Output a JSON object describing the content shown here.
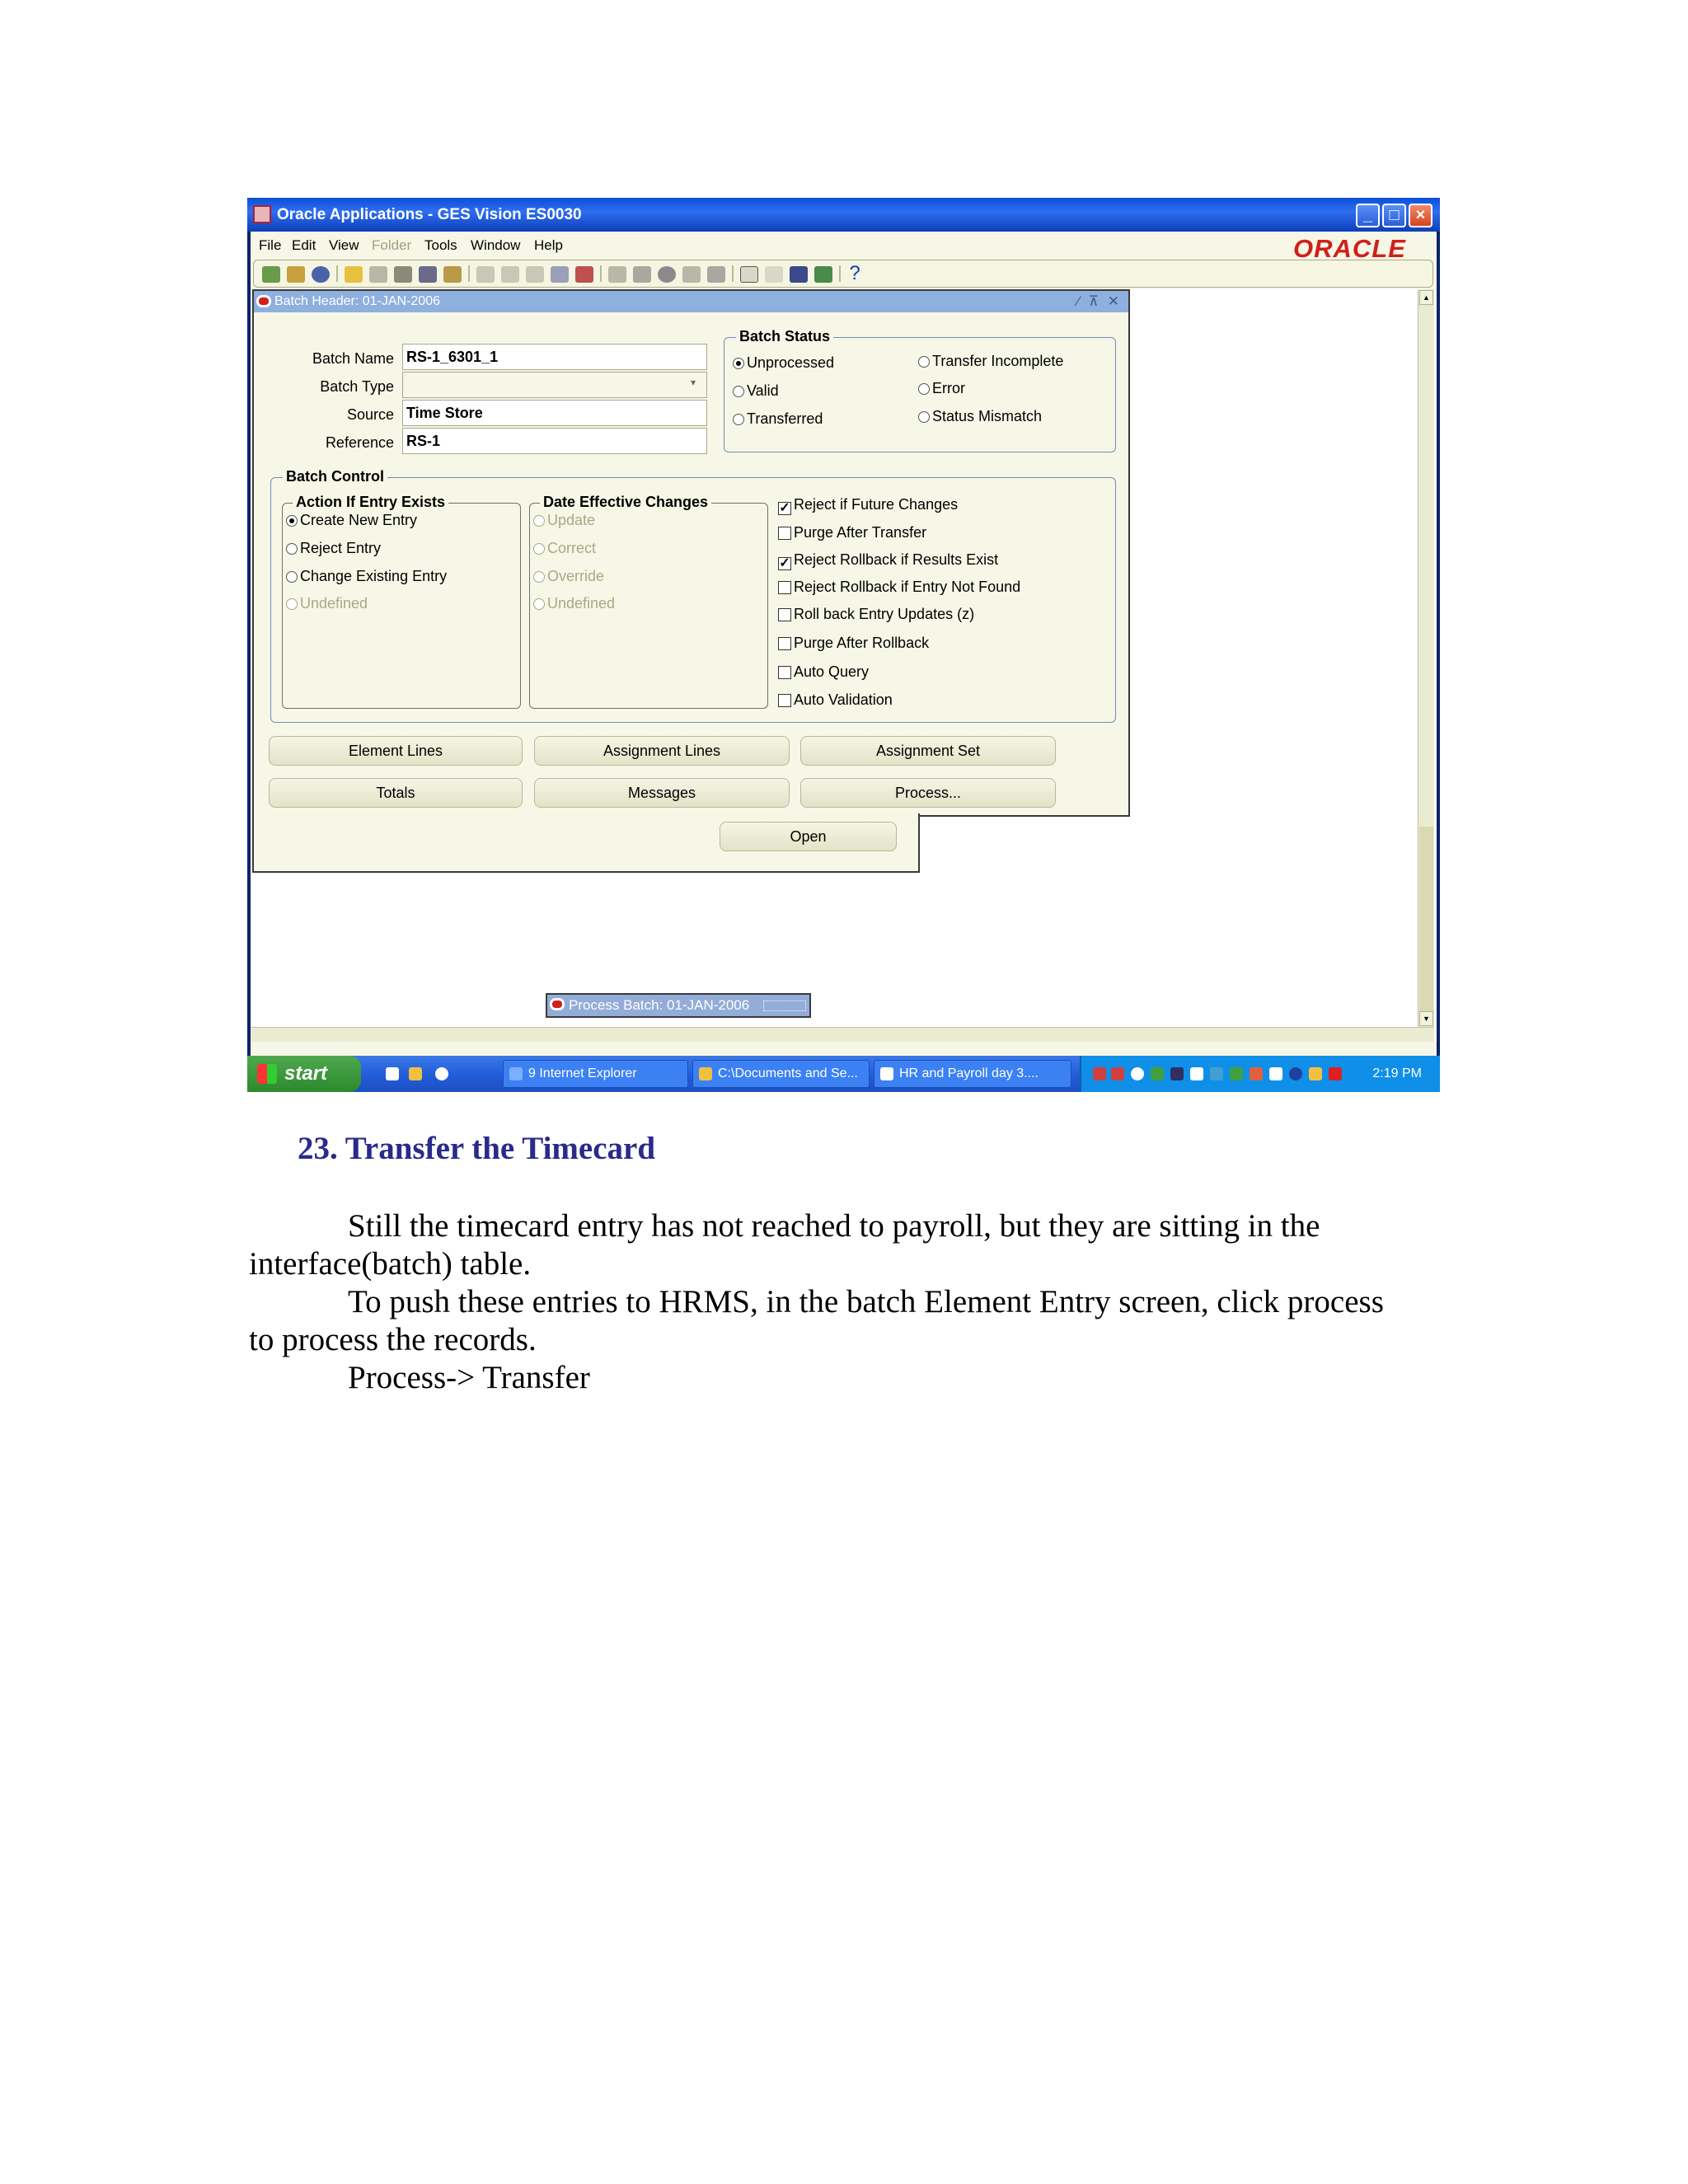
{
  "window": {
    "title": "Oracle Applications - GES Vision ES0030",
    "brand_logo": "ORACLE"
  },
  "menu": [
    "File",
    "Edit",
    "View",
    "Folder",
    "Tools",
    "Window",
    "Help"
  ],
  "batch_window": {
    "title": "Batch Header: 01-JAN-2006",
    "fields": {
      "batch_name_label": "Batch Name",
      "batch_name_value": "RS-1_6301_1",
      "batch_type_label": "Batch Type",
      "batch_type_value": "",
      "source_label": "Source",
      "source_value": "Time Store",
      "reference_label": "Reference",
      "reference_value": "RS-1"
    },
    "batch_status": {
      "title": "Batch Status",
      "options": [
        "Unprocessed",
        "Valid",
        "Transferred",
        "Transfer Incomplete",
        "Error",
        "Status Mismatch"
      ],
      "selected": "Unprocessed"
    },
    "batch_control": {
      "title": "Batch Control",
      "action_if_entry_exists": {
        "title": "Action If Entry Exists",
        "options": [
          "Create New Entry",
          "Reject Entry",
          "Change Existing Entry",
          "Undefined"
        ],
        "selected": "Create New Entry"
      },
      "date_effective_changes": {
        "title": "Date Effective Changes",
        "options": [
          "Update",
          "Correct",
          "Override",
          "Undefined"
        ]
      },
      "checkboxes": [
        {
          "label": "Reject if Future Changes",
          "checked": true
        },
        {
          "label": "Purge After Transfer",
          "checked": false
        },
        {
          "label": "Reject Rollback if Results Exist",
          "checked": true
        },
        {
          "label": "Reject Rollback if Entry Not Found",
          "checked": false
        },
        {
          "label": "Roll back Entry Updates (z)",
          "checked": false
        },
        {
          "label": "Purge After Rollback",
          "checked": false
        },
        {
          "label": "Auto Query",
          "checked": false
        },
        {
          "label": "Auto Validation",
          "checked": false
        }
      ]
    },
    "buttons": [
      "Element Lines",
      "Assignment Lines",
      "Assignment Set",
      "Totals",
      "Messages",
      "Process..."
    ]
  },
  "open_button": "Open",
  "minimized_window": "Process Batch: 01-JAN-2006",
  "taskbar": {
    "start": "start",
    "tasks": [
      "9 Internet Explorer",
      "C:\\Documents and Se...",
      "HR and Payroll day 3...."
    ],
    "clock": "2:19 PM"
  },
  "document": {
    "heading": "23. Transfer the Timecard",
    "lines": [
      "Still the timecard entry has not reached to payroll, but they are sitting in the",
      "interface(batch) table.",
      "To push these entries to HRMS, in the batch Element Entry screen, click process",
      "to process the records.",
      "Process-> Transfer"
    ]
  },
  "colors": {
    "title_bar": "#2f6ef0",
    "form_background": "#f7f7e7",
    "inner_title": "#8eb0de",
    "oracle_red": "#d0201b",
    "heading_color": "#2a2a8c"
  }
}
